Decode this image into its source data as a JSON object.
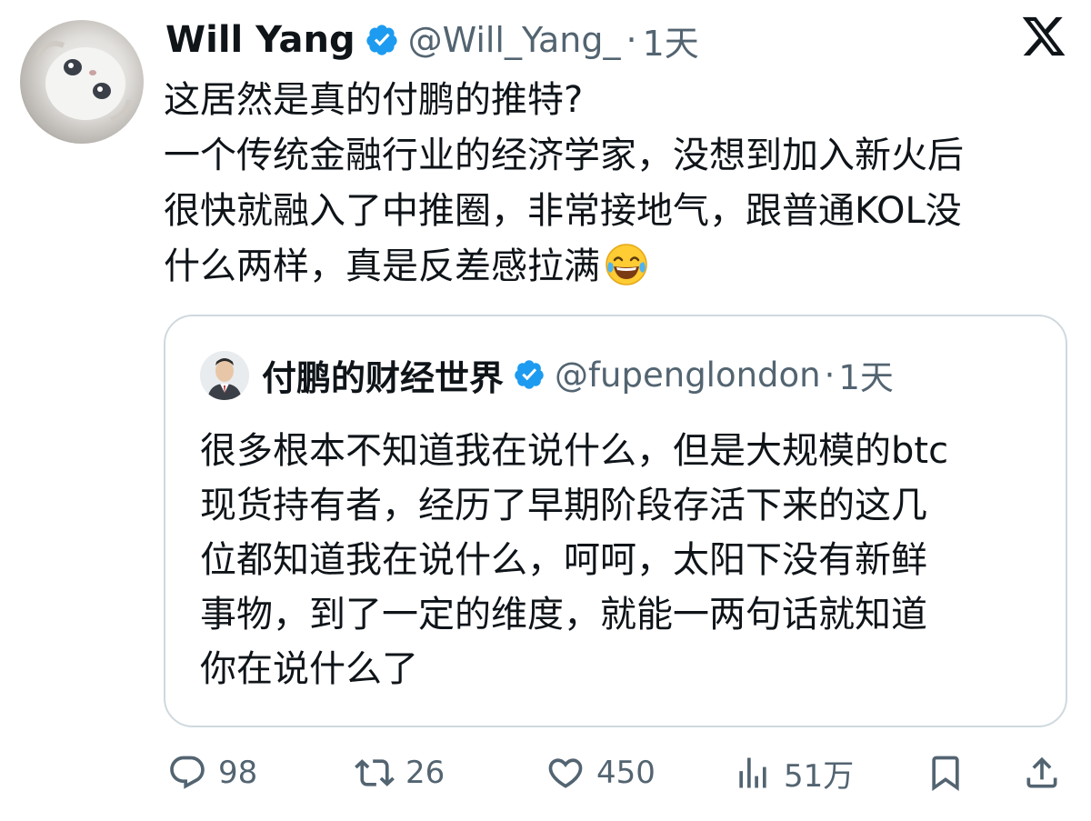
{
  "tweet": {
    "author_name": "Will Yang",
    "handle": "@Will_Yang_",
    "separator": "·",
    "time": "1天",
    "body_lines": [
      "这居然是真的付鹏的推特?",
      "一个传统金融行业的经济学家，没想到加入新火后",
      "很快就融入了中推圈，非常接地气，跟普通KOL没",
      "什么两样，真是反差感拉满"
    ],
    "emoji": "face-with-tears-of-joy"
  },
  "quote": {
    "author_name": "付鹏的财经世界",
    "handle": "@fupenglondon",
    "separator": "·",
    "time": "1天",
    "body_lines": [
      "很多根本不知道我在说什么，但是大规模的btc",
      "现货持有者，经历了早期阶段存活下来的这几",
      "位都知道我在说什么，呵呵，太阳下没有新鲜",
      "事物，到了一定的维度，就能一两句话就知道",
      "你在说什么了"
    ]
  },
  "actions": {
    "replies": "98",
    "retweets": "26",
    "likes": "450",
    "views": "51万"
  },
  "colors": {
    "text": "#0f1419",
    "secondary": "#536471",
    "verified": "#1d9bf0",
    "border": "#cfd9de"
  },
  "icons": [
    "x-logo-icon",
    "verified-badge-icon",
    "reply-icon",
    "retweet-icon",
    "like-icon",
    "views-icon",
    "bookmark-icon",
    "share-icon"
  ]
}
